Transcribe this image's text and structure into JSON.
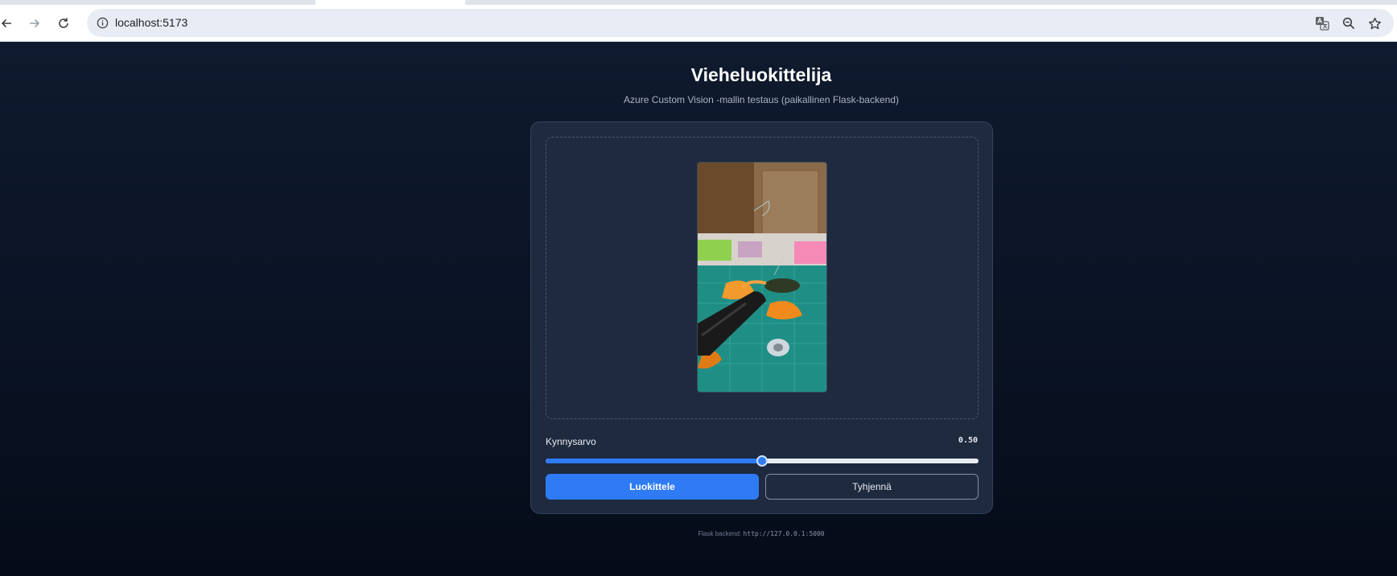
{
  "browser": {
    "url": "localhost:5173",
    "icons": [
      "back-arrow-icon",
      "forward-arrow-icon",
      "reload-icon",
      "site-info-icon",
      "translate-icon",
      "zoom-icon",
      "bookmark-star-icon"
    ]
  },
  "header": {
    "title": "Vieheluokittelija",
    "subtitle": "Azure Custom Vision -mallin testaus (paikallinen Flask-backend)"
  },
  "threshold": {
    "label": "Kynnysarvo",
    "value_text": "0.50",
    "value": 0.5,
    "min": 0,
    "max": 1
  },
  "actions": {
    "classify_label": "Luokittele",
    "clear_label": "Tyhjennä"
  },
  "footer": {
    "label": "Flask backend:",
    "backend_url": "http://127.0.0.1:5000"
  },
  "colors": {
    "accent": "#2f7bf6",
    "card": "#1e2a3e",
    "page": "#0b1220"
  }
}
